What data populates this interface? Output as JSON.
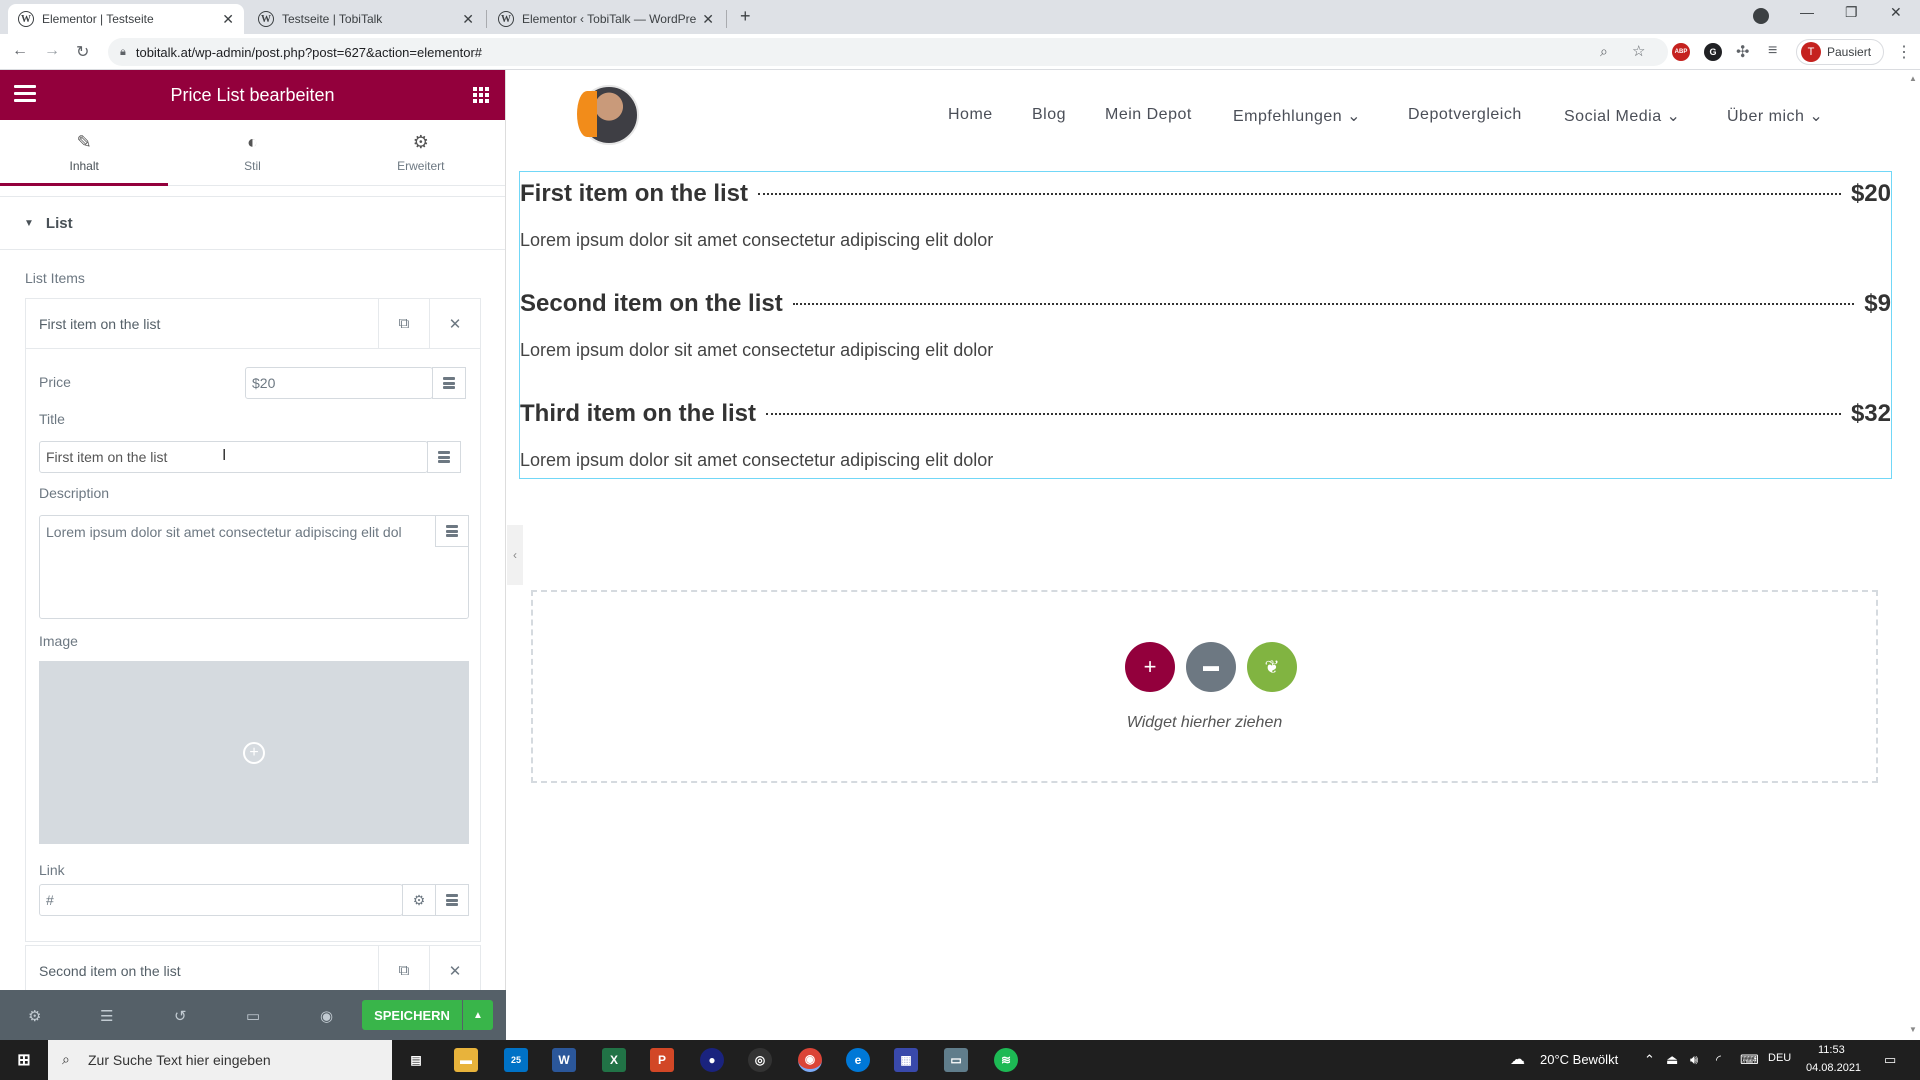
{
  "browser": {
    "tabs": [
      {
        "label": "Elementor | Testseite",
        "active": true
      },
      {
        "label": "Testseite | TobiTalk",
        "active": false
      },
      {
        "label": "Elementor ‹ TobiTalk — WordPre",
        "active": false
      }
    ],
    "new_tab": "+",
    "url": "tobitalk.at/wp-admin/post.php?post=627&action=elementor#",
    "profile_initial": "T",
    "profile_label": "Pausiert",
    "ext_abp": "ABP"
  },
  "panel": {
    "title": "Price List bearbeiten",
    "tabs": [
      {
        "label": "Inhalt",
        "active": true
      },
      {
        "label": "Stil",
        "active": false
      },
      {
        "label": "Erweitert",
        "active": false
      }
    ],
    "section_title": "List",
    "list_items_label": "List Items",
    "item1": {
      "title": "First item on the list",
      "price_label": "Price",
      "price_value": "$20",
      "title_label": "Title",
      "title_value": "First item on the list",
      "description_label": "Description",
      "description_value": "Lorem ipsum dolor sit amet consectetur adipiscing elit dol",
      "image_label": "Image",
      "link_label": "Link",
      "link_value": "#"
    },
    "item2": {
      "title": "Second item on the list"
    },
    "save_label": "SPEICHERN"
  },
  "site": {
    "nav": [
      {
        "label": "Home"
      },
      {
        "label": "Blog"
      },
      {
        "label": "Mein Depot"
      },
      {
        "label": "Empfehlungen ⌄"
      },
      {
        "label": "Depotvergleich"
      },
      {
        "label": "Social Media ⌄"
      },
      {
        "label": "Über mich ⌄"
      }
    ],
    "price_list": [
      {
        "title": "First item on the list",
        "price": "$20",
        "description": "Lorem ipsum dolor sit amet consectetur adipiscing elit dolor"
      },
      {
        "title": "Second item on the list",
        "price": "$9",
        "description": "Lorem ipsum dolor sit amet consectetur adipiscing elit dolor"
      },
      {
        "title": "Third item on the list",
        "price": "$32",
        "description": "Lorem ipsum dolor sit amet consectetur adipiscing elit dolor"
      }
    ],
    "dropzone_text": "Widget hierher ziehen"
  },
  "taskbar": {
    "search_placeholder": "Zur Suche Text hier eingeben",
    "weather": "20°C  Bewölkt",
    "lang": "DEU",
    "time": "11:53",
    "date": "04.08.2021",
    "badge": "25"
  },
  "colors": {
    "elementor_brand": "#93003c",
    "save_green": "#39b54a",
    "dz_add": "#93003c",
    "dz_folder": "#6d7882",
    "dz_envato": "#81b441"
  }
}
